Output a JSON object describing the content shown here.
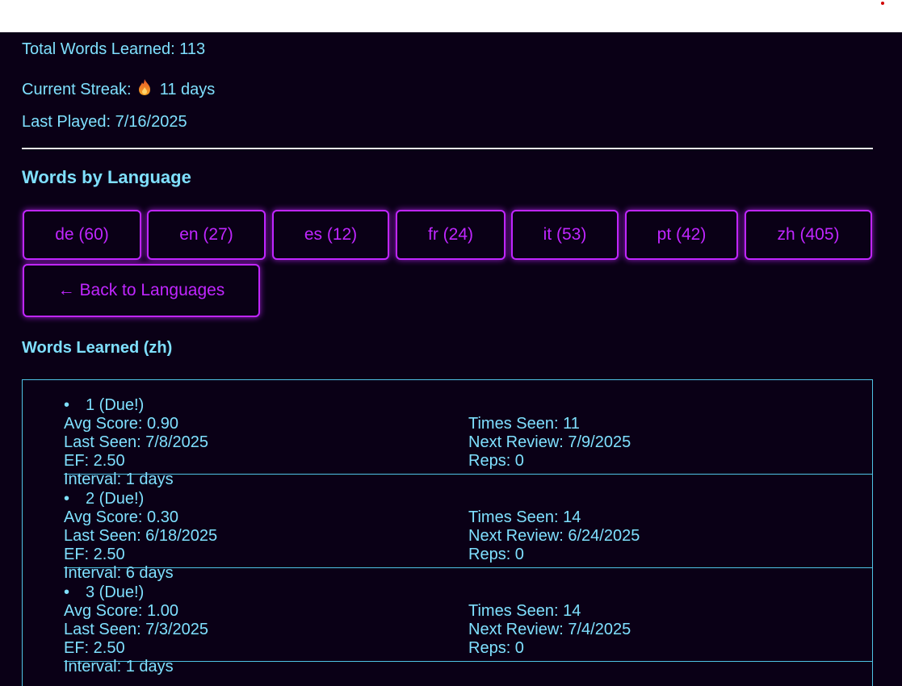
{
  "stats": {
    "total": "Total Words Learned: 113",
    "streak_label": "Current Streak:",
    "streak_icon": "fire-icon",
    "streak_value": "11 days",
    "last_played": "Last Played: 7/16/2025"
  },
  "section_title": "Words by Language",
  "languages": [
    {
      "label": "de (60)"
    },
    {
      "label": "en (27)"
    },
    {
      "label": "es (12)"
    },
    {
      "label": "fr (24)"
    },
    {
      "label": "it (53)"
    },
    {
      "label": "pt (42)"
    },
    {
      "label": "zh (405)"
    }
  ],
  "back_button": "← Back to Languages",
  "words_title": "Words Learned (zh)",
  "words": [
    {
      "title": "1 (Due!)",
      "avg_score": "Avg Score: 0.90",
      "last_seen": "Last Seen: 7/8/2025",
      "ef": "EF: 2.50",
      "interval": "Interval: 1 days",
      "times_seen": "Times Seen: 11",
      "next_review": "Next Review: 7/9/2025",
      "reps": "Reps: 0"
    },
    {
      "title": "2 (Due!)",
      "avg_score": "Avg Score: 0.30",
      "last_seen": "Last Seen: 6/18/2025",
      "ef": "EF: 2.50",
      "interval": "Interval: 6 days",
      "times_seen": "Times Seen: 14",
      "next_review": "Next Review: 6/24/2025",
      "reps": "Reps: 0"
    },
    {
      "title": "3 (Due!)",
      "avg_score": "Avg Score: 1.00",
      "last_seen": "Last Seen: 7/3/2025",
      "ef": "EF: 2.50",
      "interval": "Interval: 1 days",
      "times_seen": "Times Seen: 14",
      "next_review": "Next Review: 7/4/2025",
      "reps": "Reps: 0"
    }
  ],
  "colors": {
    "background": "#0a0016",
    "text": "#7fe0ff",
    "accent": "#c026ff"
  }
}
